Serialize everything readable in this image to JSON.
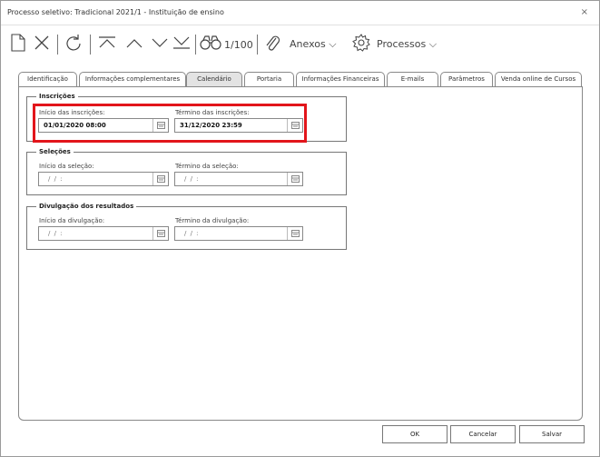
{
  "window": {
    "title": "Processo seletivo: Tradicional 2021/1 - Instituição de ensino",
    "close_glyph": "×"
  },
  "toolbar": {
    "icons": [
      "new-document-icon",
      "delete-x-icon",
      "refresh-icon",
      "first-record-icon",
      "previous-record-icon",
      "next-record-icon",
      "last-record-icon",
      "binoculars-icon",
      "paperclip-icon",
      "gear-icon"
    ],
    "record_counter": "1/100",
    "anexos_label": "Anexos",
    "processos_label": "Processos",
    "dropdown_glyph": "⌵"
  },
  "tabs": [
    {
      "label": "Identificação"
    },
    {
      "label": "Informações complementares"
    },
    {
      "label": "Calendário",
      "active": true
    },
    {
      "label": "Portaria"
    },
    {
      "label": "Informações Financeiras"
    },
    {
      "label": "E-mails"
    },
    {
      "label": "Parâmetros"
    },
    {
      "label": "Venda online de Cursos"
    }
  ],
  "groups": {
    "inscricoes": {
      "legend": "Inscrições",
      "start_label": "Início das inscrições:",
      "start_value": "01/01/2020 08:00",
      "end_label": "Término das inscrições:",
      "end_value": "31/12/2020 23:59"
    },
    "selecoes": {
      "legend": "Seleções",
      "start_label": "Início da seleção:",
      "start_placeholder": "/ /   :",
      "end_label": "Término da seleção:",
      "end_placeholder": "/ /   :"
    },
    "divulgacao": {
      "legend": "Divulgação dos resultados",
      "start_label": "Início da divulgação:",
      "start_placeholder": "/ /   :",
      "end_label": "Término da divulgação:",
      "end_placeholder": "/ /   :"
    }
  },
  "highlight_color": "#e2151b",
  "buttons": {
    "ok": "OK",
    "cancel": "Cancelar",
    "save": "Salvar"
  }
}
